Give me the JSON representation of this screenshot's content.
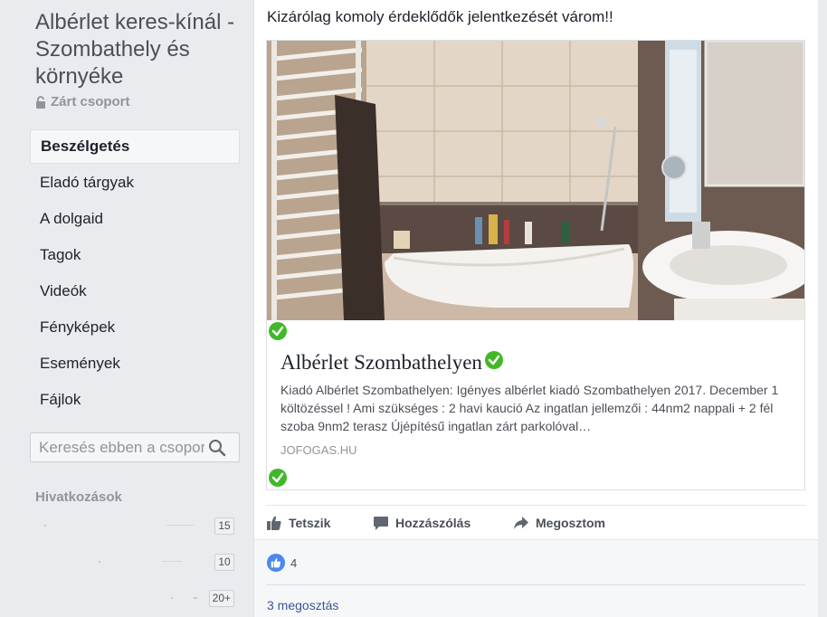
{
  "group": {
    "title": "Albérlet keres-kínál - Szombathely és környéke",
    "privacy": "Zárt csoport"
  },
  "nav": {
    "items": [
      {
        "label": "Beszélgetés",
        "active": true
      },
      {
        "label": "Eladó tárgyak"
      },
      {
        "label": "A dolgaid"
      },
      {
        "label": "Tagok"
      },
      {
        "label": "Videók"
      },
      {
        "label": "Fényképek"
      },
      {
        "label": "Események"
      },
      {
        "label": "Fájlok"
      }
    ]
  },
  "search": {
    "placeholder": "Keresés ebben a csoportban"
  },
  "shortcuts": {
    "title": "Hivatkozások",
    "badges": [
      "15",
      "10",
      "20+"
    ]
  },
  "post": {
    "text": "Kizárólag komoly érdeklődők jelentkezését várom!!",
    "link": {
      "title": "Albérlet Szombathelyen",
      "description": "Kiadó Albérlet Szombathelyen: Igényes albérlet kiadó Szombathelyen 2017. December 1 költözéssel ! Ami szükséges : 2 havi kaució Az ingatlan jellemzői : 44nm2 nappali + 2 fél szoba 9nm2 terasz Újépítésű ingatlan zárt parkolóval…",
      "domain": "JOFOGAS.HU"
    },
    "actions": {
      "like": "Tetszik",
      "comment": "Hozzászólás",
      "share": "Megosztom"
    },
    "reactions_count": "4",
    "shares": "3 megosztás"
  },
  "colors": {
    "link_blue": "#385898",
    "like_blue": "#4b88f0",
    "check_green": "#42b72a"
  }
}
